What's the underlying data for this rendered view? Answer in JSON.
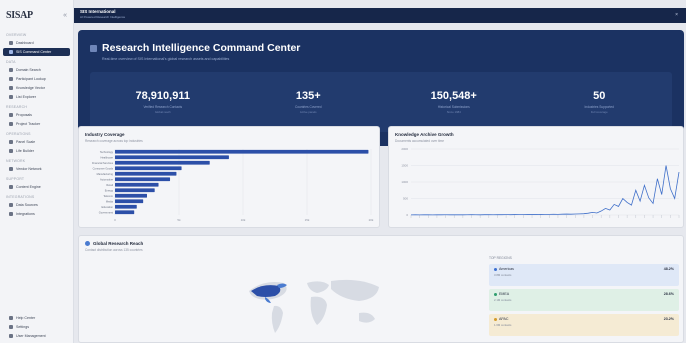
{
  "sidebar": {
    "logo": "SISAP",
    "collapse": "«",
    "items": [
      {
        "label": "",
        "section": "Overview"
      },
      {
        "label": "Dashboard"
      },
      {
        "label": "SIS Command Center",
        "active": true
      },
      {
        "label": "",
        "section": "Data"
      },
      {
        "label": "Domain Search"
      },
      {
        "label": "Participant Lookup"
      },
      {
        "label": "Knowledge Vector"
      },
      {
        "label": "List Explorer"
      },
      {
        "label": "",
        "section": "Research"
      },
      {
        "label": "Proposals"
      },
      {
        "label": "Project Tracker"
      },
      {
        "label": "",
        "section": "Operations"
      },
      {
        "label": "Panel Scale"
      },
      {
        "label": "Life Builder"
      },
      {
        "label": "",
        "section": "Network"
      },
      {
        "label": "Vendor Network"
      },
      {
        "label": "",
        "section": "Support"
      },
      {
        "label": "Content Engine"
      },
      {
        "label": "",
        "section": "Integrations"
      },
      {
        "label": "Data Sources"
      },
      {
        "label": "Integrations"
      }
    ],
    "bottom": [
      {
        "label": "Help Center"
      },
      {
        "label": "Settings"
      },
      {
        "label": "User Management"
      }
    ]
  },
  "topbar": {
    "title": "SIS International",
    "subtitle": "AI Powered Research Intelligence",
    "close": "×"
  },
  "hero": {
    "title": "Research Intelligence Command Center",
    "subtitle": "Real-time overview of SIS International's global research assets and capabilities",
    "stats": [
      {
        "value": "78,910,911",
        "label": "Verified Research Contacts",
        "sub": "Global reach"
      },
      {
        "value": "135+",
        "label": "Countries Covered",
        "sub": "Active panels"
      },
      {
        "value": "150,548+",
        "label": "Historical Submissions",
        "sub": "Since 1984"
      },
      {
        "value": "50",
        "label": "Industries Supported",
        "sub": "Full coverage"
      }
    ]
  },
  "coverage": {
    "title": "Industry Coverage",
    "subtitle": "Research coverage across top industries"
  },
  "archive": {
    "title": "Knowledge Archive Growth",
    "subtitle": "Documents accumulated over time"
  },
  "reach": {
    "title": "Global Research Reach",
    "subtitle": "Contact distribution across 135 countries",
    "regions_header": "TOP REGIONS",
    "regions": [
      {
        "name": "Americas",
        "detail": "3.8M contacts",
        "pct": "48.2%",
        "color": "#3c6fd1",
        "bg": "#dfe8f7"
      },
      {
        "name": "EMEA",
        "detail": "2.1M contacts",
        "pct": "28.6%",
        "color": "#2f9e6f",
        "bg": "#dff0e6"
      },
      {
        "name": "APAC",
        "detail": "1.6M contacts",
        "pct": "23.2%",
        "color": "#d49a2a",
        "bg": "#f5ebd4"
      }
    ]
  },
  "colors": {
    "navy": "#1b3262",
    "bar": "#2c4fa8",
    "line": "#3f6fc9",
    "accent": "#4a7bd0"
  },
  "chart_data": [
    {
      "type": "bar",
      "orientation": "horizontal",
      "title": "Industry Coverage",
      "categories": [
        "Technology",
        "Healthcare",
        "Financial Services",
        "Consumer Goods",
        "Manufacturing",
        "Automotive",
        "Retail",
        "Energy",
        "Telecom",
        "Media",
        "Education",
        "Government"
      ],
      "values": [
        19800,
        8900,
        7400,
        5200,
        4800,
        4300,
        3400,
        3100,
        2500,
        2200,
        1700,
        1500
      ],
      "xlim": [
        0,
        20000
      ],
      "xticks": [
        "0",
        "5k",
        "10k",
        "15k",
        "20k"
      ]
    },
    {
      "type": "line",
      "title": "Knowledge Archive Growth",
      "yticks": [
        "0",
        "500",
        "1000",
        "1500",
        "2000"
      ],
      "ylim": [
        0,
        2000
      ],
      "values": [
        4,
        5,
        3,
        6,
        5,
        4,
        6,
        5,
        7,
        6,
        5,
        8,
        6,
        7,
        9,
        8,
        6,
        9,
        10,
        8,
        11,
        9,
        12,
        10,
        13,
        11,
        12,
        14,
        16,
        13,
        18,
        15,
        20,
        22,
        19,
        25,
        28,
        24,
        30,
        35,
        40,
        55,
        80,
        60,
        120,
        200,
        150,
        320,
        260,
        500,
        380,
        300,
        750,
        420,
        900,
        520,
        350,
        1100,
        620,
        1500,
        800,
        500,
        1300
      ]
    }
  ]
}
